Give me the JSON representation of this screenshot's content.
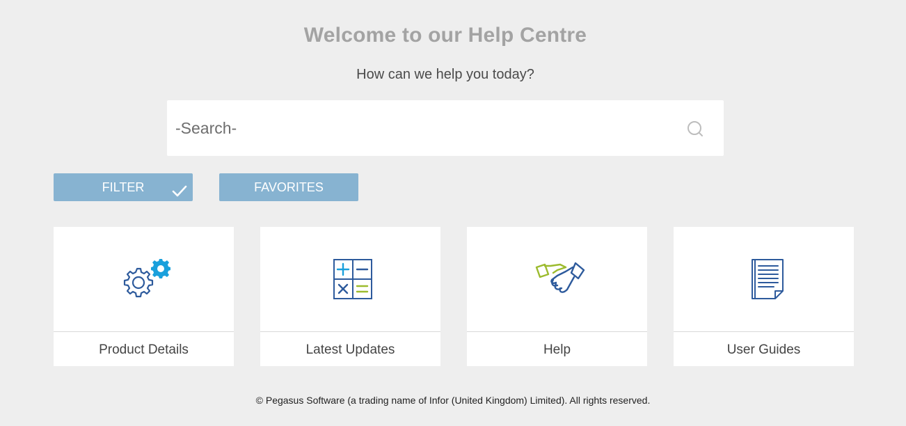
{
  "header": {
    "title": "Welcome to our Help Centre",
    "subtitle": "How can we help you today?"
  },
  "search": {
    "placeholder": "-Search-",
    "icon": "search-icon"
  },
  "buttons": {
    "filter_label": "FILTER",
    "filter_icon": "check-icon",
    "favorites_label": "FAVORITES",
    "color": "#87b3d1"
  },
  "cards": [
    {
      "label": "Product Details",
      "icon": "gears-icon"
    },
    {
      "label": "Latest Updates",
      "icon": "calculator-icon"
    },
    {
      "label": "Help",
      "icon": "handshake-icon"
    },
    {
      "label": "User Guides",
      "icon": "document-icon"
    }
  ],
  "footer": {
    "text": "© Pegasus Software (a trading name of Infor (United Kingdom) Limited). All rights reserved."
  },
  "colors": {
    "background": "#eeeeee",
    "icon_dark_blue": "#2d5a9c",
    "icon_light_blue": "#1aa0dc",
    "icon_green": "#9cbb2e"
  }
}
